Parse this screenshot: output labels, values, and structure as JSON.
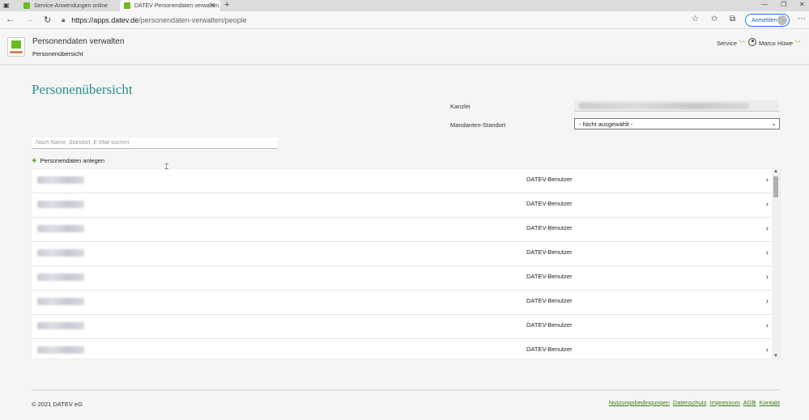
{
  "browser": {
    "tabs": [
      {
        "label": "Service-Anwendungen online",
        "active": false
      },
      {
        "label": "DATEV Personendaten verwalten",
        "active": true
      }
    ],
    "url_host": "https://apps.datev.de",
    "url_path": "/personendaten-verwalten/people",
    "signin_label": "Anmelden"
  },
  "app": {
    "title": "Personendaten verwalten",
    "subtitle": "Personenübersicht",
    "service_label": "Service",
    "user_name": "Marco Hüwe"
  },
  "page": {
    "heading": "Personenübersicht",
    "kanzlei_label": "Kanzlei",
    "standort_label": "Mandanten-Standort",
    "standort_value": "- Nicht ausgewählt -",
    "search_placeholder": "Nach Name, Standort, E-Mail suchen",
    "add_label": "Personendaten anlegen"
  },
  "people": [
    {
      "role": "DATEV-Benutzer"
    },
    {
      "role": "DATEV-Benutzer"
    },
    {
      "role": "DATEV-Benutzer"
    },
    {
      "role": "DATEV-Benutzer"
    },
    {
      "role": "DATEV-Benutzer"
    },
    {
      "role": "DATEV-Benutzer"
    },
    {
      "role": "DATEV-Benutzer"
    },
    {
      "role": "DATEV-Benutzer"
    }
  ],
  "footer": {
    "copyright": "© 2021 DATEV eG",
    "links": [
      "Nutzungsbedingungen",
      "Datenschutz",
      "Impressum",
      "AGB",
      "Kontakt"
    ]
  },
  "colors": {
    "accent_green": "#6cbb1e",
    "heading_teal": "#2a8f8a",
    "link_green": "#3b7d12"
  }
}
